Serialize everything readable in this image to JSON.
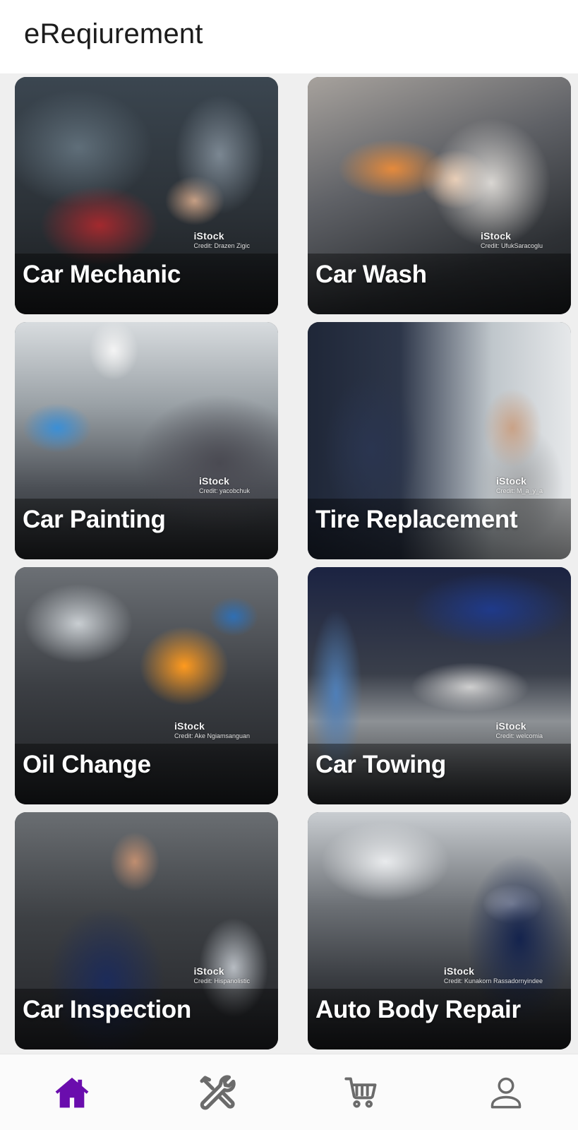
{
  "app": {
    "title": "eReqiurement"
  },
  "services": [
    {
      "title": "Car Mechanic",
      "watermark": "iStock",
      "credit": "Credit: Drazen Zigic"
    },
    {
      "title": "Car Wash",
      "watermark": "iStock",
      "credit": "Credit: UfukSaracoglu"
    },
    {
      "title": "Car Painting",
      "watermark": "iStock",
      "credit": "Credit: yacobchuk"
    },
    {
      "title": "Tire Replacement",
      "watermark": "iStock",
      "credit": "Credit: M_a_y_a"
    },
    {
      "title": "Oil Change",
      "watermark": "iStock",
      "credit": "Credit: Ake Ngiamsanguan"
    },
    {
      "title": "Car Towing",
      "watermark": "iStock",
      "credit": "Credit: welcomia"
    },
    {
      "title": "Car Inspection",
      "watermark": "iStock",
      "credit": "Credit: Hispanolistic"
    },
    {
      "title": "Auto Body Repair",
      "watermark": "iStock",
      "credit": "Credit: Kunakorn Rassadornyindee"
    }
  ],
  "bottom_nav": {
    "items": [
      {
        "icon": "home-icon",
        "active": true
      },
      {
        "icon": "tools-icon",
        "active": false
      },
      {
        "icon": "cart-icon",
        "active": false
      },
      {
        "icon": "profile-icon",
        "active": false
      }
    ],
    "active_color": "#6a0dad",
    "inactive_color": "#6b6b6b"
  }
}
